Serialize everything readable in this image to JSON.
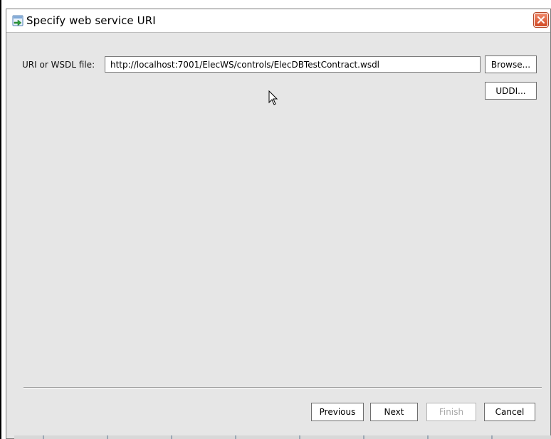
{
  "window": {
    "title": "Specify web service URI",
    "title_icon": "wizard-app-icon",
    "close_icon": "close-icon"
  },
  "form": {
    "uri_label": "URI or WSDL file:",
    "uri_value": "http://localhost:7001/ElecWS/controls/ElecDBTestContract.wsdl",
    "browse_label": "Browse...",
    "uddi_label": "UDDI..."
  },
  "footer": {
    "previous_label": "Previous",
    "next_label": "Next",
    "finish_label": "Finish",
    "finish_enabled": false,
    "cancel_label": "Cancel"
  },
  "colors": {
    "dialog_background": "#e6e6e6",
    "titlebar_background": "#ffffff",
    "close_button": "#d24a25"
  }
}
